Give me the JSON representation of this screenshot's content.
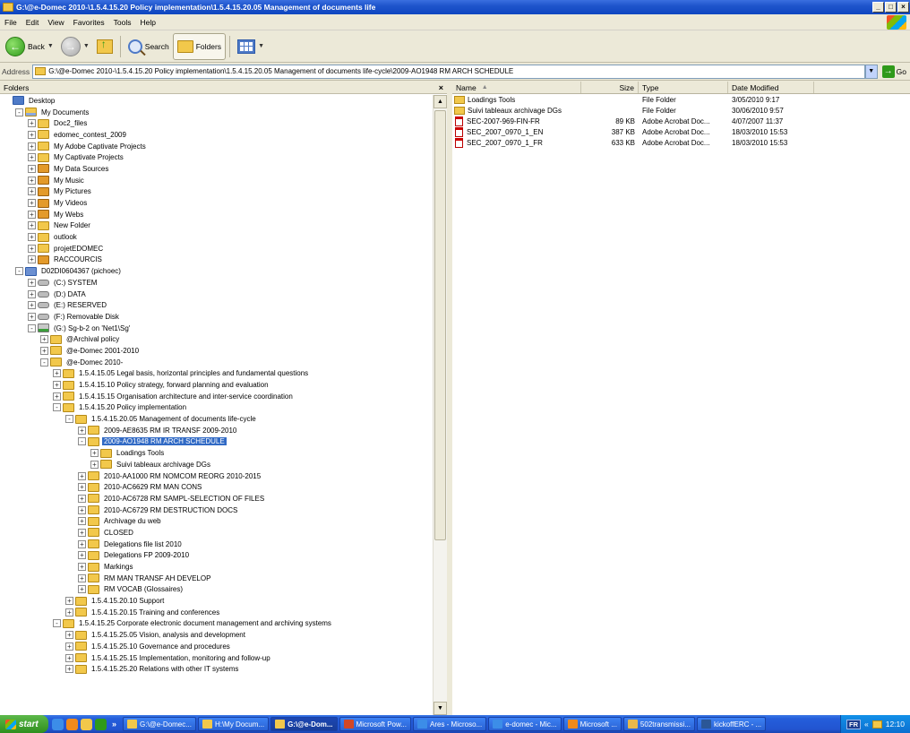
{
  "window": {
    "title": "G:\\@e-Domec 2010-\\1.5.4.15.20 Policy implementation\\1.5.4.15.20.05 Management of documents life",
    "buttons": {
      "minimize": "_",
      "maximize": "□",
      "close": "×"
    }
  },
  "menu": [
    "File",
    "Edit",
    "View",
    "Favorites",
    "Tools",
    "Help"
  ],
  "toolbar": {
    "back_label": "Back",
    "search_label": "Search",
    "folders_label": "Folders"
  },
  "address": {
    "label": "Address",
    "value": "G:\\@e-Domec 2010-\\1.5.4.15.20 Policy implementation\\1.5.4.15.20.05 Management of documents life-cycle\\2009-AO1948 RM ARCH SCHEDULE",
    "go_label": "Go"
  },
  "folders_pane": {
    "title": "Folders",
    "close": "×",
    "tree": [
      {
        "label": "Desktop",
        "level": 0,
        "exp": "",
        "icon": "desktop"
      },
      {
        "label": "My Documents",
        "level": 1,
        "exp": "-",
        "icon": "docs"
      },
      {
        "label": "Doc2_files",
        "level": 2,
        "exp": "+",
        "icon": "folder"
      },
      {
        "label": "edomec_contest_2009",
        "level": 2,
        "exp": "+",
        "icon": "folder"
      },
      {
        "label": "My Adobe Captivate Projects",
        "level": 2,
        "exp": "+",
        "icon": "folder"
      },
      {
        "label": "My Captivate Projects",
        "level": 2,
        "exp": "+",
        "icon": "folder"
      },
      {
        "label": "My Data Sources",
        "level": 2,
        "exp": "+",
        "icon": "special"
      },
      {
        "label": "My Music",
        "level": 2,
        "exp": "+",
        "icon": "special"
      },
      {
        "label": "My Pictures",
        "level": 2,
        "exp": "+",
        "icon": "special"
      },
      {
        "label": "My Videos",
        "level": 2,
        "exp": "+",
        "icon": "special"
      },
      {
        "label": "My Webs",
        "level": 2,
        "exp": "+",
        "icon": "special"
      },
      {
        "label": "New Folder",
        "level": 2,
        "exp": "+",
        "icon": "folder"
      },
      {
        "label": "outlook",
        "level": 2,
        "exp": "+",
        "icon": "folder"
      },
      {
        "label": "projetEDOMEC",
        "level": 2,
        "exp": "+",
        "icon": "folder"
      },
      {
        "label": "RACCOURCIS",
        "level": 2,
        "exp": "+",
        "icon": "special"
      },
      {
        "label": "D02DI0604367 (pichoec)",
        "level": 1,
        "exp": "-",
        "icon": "computer"
      },
      {
        "label": "(C:) SYSTEM",
        "level": 2,
        "exp": "+",
        "icon": "drive"
      },
      {
        "label": "(D:) DATA",
        "level": 2,
        "exp": "+",
        "icon": "drive"
      },
      {
        "label": "(E:) RESERVED",
        "level": 2,
        "exp": "+",
        "icon": "drive"
      },
      {
        "label": "(F:) Removable Disk",
        "level": 2,
        "exp": "+",
        "icon": "drive"
      },
      {
        "label": "(G:) Sg-b-2 on 'Net1\\Sg'",
        "level": 2,
        "exp": "-",
        "icon": "netdrive"
      },
      {
        "label": "@Archival policy",
        "level": 3,
        "exp": "+",
        "icon": "folder"
      },
      {
        "label": "@e-Domec 2001-2010",
        "level": 3,
        "exp": "+",
        "icon": "folder"
      },
      {
        "label": "@e-Domec 2010-",
        "level": 3,
        "exp": "-",
        "icon": "folder"
      },
      {
        "label": "1.5.4.15.05 Legal basis, horizontal principles and fundamental questions",
        "level": 4,
        "exp": "+",
        "icon": "folder"
      },
      {
        "label": "1.5.4.15.10 Policy strategy, forward planning and evaluation",
        "level": 4,
        "exp": "+",
        "icon": "folder"
      },
      {
        "label": "1.5.4.15.15 Organisation architecture and inter-service coordination",
        "level": 4,
        "exp": "+",
        "icon": "folder"
      },
      {
        "label": "1.5.4.15.20 Policy implementation",
        "level": 4,
        "exp": "-",
        "icon": "folder"
      },
      {
        "label": "1.5.4.15.20.05 Management of documents life-cycle",
        "level": 5,
        "exp": "-",
        "icon": "folder"
      },
      {
        "label": "2009-AE8635 RM IR TRANSF 2009-2010",
        "level": 6,
        "exp": "+",
        "icon": "folder"
      },
      {
        "label": "2009-AO1948 RM ARCH SCHEDULE",
        "level": 6,
        "exp": "-",
        "icon": "folder",
        "selected": true
      },
      {
        "label": "Loadings Tools",
        "level": 7,
        "exp": "+",
        "icon": "folder"
      },
      {
        "label": "Suivi tableaux archivage DGs",
        "level": 7,
        "exp": "+",
        "icon": "folder"
      },
      {
        "label": "2010-AA1000 RM NOMCOM REORG 2010-2015",
        "level": 6,
        "exp": "+",
        "icon": "folder"
      },
      {
        "label": "2010-AC6629 RM MAN CONS",
        "level": 6,
        "exp": "+",
        "icon": "folder"
      },
      {
        "label": "2010-AC6728 RM SAMPL-SELECTION OF FILES",
        "level": 6,
        "exp": "+",
        "icon": "folder"
      },
      {
        "label": "2010-AC6729 RM DESTRUCTION DOCS",
        "level": 6,
        "exp": "+",
        "icon": "folder"
      },
      {
        "label": "Archivage du web",
        "level": 6,
        "exp": "+",
        "icon": "folder"
      },
      {
        "label": "CLOSED",
        "level": 6,
        "exp": "+",
        "icon": "folder"
      },
      {
        "label": "Delegations file list 2010",
        "level": 6,
        "exp": "+",
        "icon": "folder"
      },
      {
        "label": "Delegations FP 2009-2010",
        "level": 6,
        "exp": "+",
        "icon": "folder"
      },
      {
        "label": "Markings",
        "level": 6,
        "exp": "+",
        "icon": "folder"
      },
      {
        "label": "RM MAN TRANSF AH DEVELOP",
        "level": 6,
        "exp": "+",
        "icon": "folder"
      },
      {
        "label": "RM VOCAB (Glossaires)",
        "level": 6,
        "exp": "+",
        "icon": "folder"
      },
      {
        "label": "1.5.4.15.20.10 Support",
        "level": 5,
        "exp": "+",
        "icon": "folder"
      },
      {
        "label": "1.5.4.15.20.15 Training and conferences",
        "level": 5,
        "exp": "+",
        "icon": "folder"
      },
      {
        "label": "1.5.4.15.25 Corporate electronic document management and archiving systems",
        "level": 4,
        "exp": "-",
        "icon": "folder"
      },
      {
        "label": "1.5.4.15.25.05 Vision, analysis and development",
        "level": 5,
        "exp": "+",
        "icon": "folder"
      },
      {
        "label": "1.5.4.15.25.10 Governance and procedures",
        "level": 5,
        "exp": "+",
        "icon": "folder"
      },
      {
        "label": "1.5.4.15.25.15 Implementation, monitoring and follow-up",
        "level": 5,
        "exp": "+",
        "icon": "folder"
      },
      {
        "label": "1.5.4.15.25.20 Relations with other IT systems",
        "level": 5,
        "exp": "+",
        "icon": "folder"
      }
    ]
  },
  "files_pane": {
    "columns": {
      "name": "Name",
      "size": "Size",
      "type": "Type",
      "date": "Date Modified"
    },
    "files": [
      {
        "name": "Loadings Tools",
        "size": "",
        "type": "File Folder",
        "date": "3/05/2010 9:17",
        "icon": "folder"
      },
      {
        "name": "Suivi tableaux archivage DGs",
        "size": "",
        "type": "File Folder",
        "date": "30/06/2010 9:57",
        "icon": "folder"
      },
      {
        "name": "SEC-2007-969-FIN-FR",
        "size": "89 KB",
        "type": "Adobe Acrobat Doc...",
        "date": "4/07/2007 11:37",
        "icon": "pdf"
      },
      {
        "name": "SEC_2007_0970_1_EN",
        "size": "387 KB",
        "type": "Adobe Acrobat Doc...",
        "date": "18/03/2010 15:53",
        "icon": "pdf"
      },
      {
        "name": "SEC_2007_0970_1_FR",
        "size": "633 KB",
        "type": "Adobe Acrobat Doc...",
        "date": "18/03/2010 15:53",
        "icon": "pdf"
      }
    ]
  },
  "taskbar": {
    "start_label": "start",
    "more": "»",
    "tasks": [
      {
        "label": "G:\\@e-Domec...",
        "icon_color": "#f2c84b",
        "active": false
      },
      {
        "label": "H:\\My Docum...",
        "icon_color": "#f2c84b",
        "active": false
      },
      {
        "label": "G:\\@e-Dom...",
        "icon_color": "#f2c84b",
        "active": true
      },
      {
        "label": "Microsoft Pow...",
        "icon_color": "#d24726",
        "active": false
      },
      {
        "label": "Ares - Microso...",
        "icon_color": "#3c8de8",
        "active": false
      },
      {
        "label": "e-domec - Mic...",
        "icon_color": "#3c8de8",
        "active": false
      },
      {
        "label": "Microsoft ...",
        "icon_color": "#f08a1c",
        "active": false
      },
      {
        "label": "502transmissi...",
        "icon_color": "#e8b84a",
        "active": false
      },
      {
        "label": "kickoffERC - ...",
        "icon_color": "#2b5797",
        "active": false
      }
    ],
    "tray": {
      "lang": "FR",
      "chevron": "«",
      "clock": "12:10"
    }
  },
  "colors": {
    "title_bar": "#0e46c0",
    "selection": "#316ac5",
    "taskbar": "#245edb",
    "start": "#2f8f1e"
  }
}
